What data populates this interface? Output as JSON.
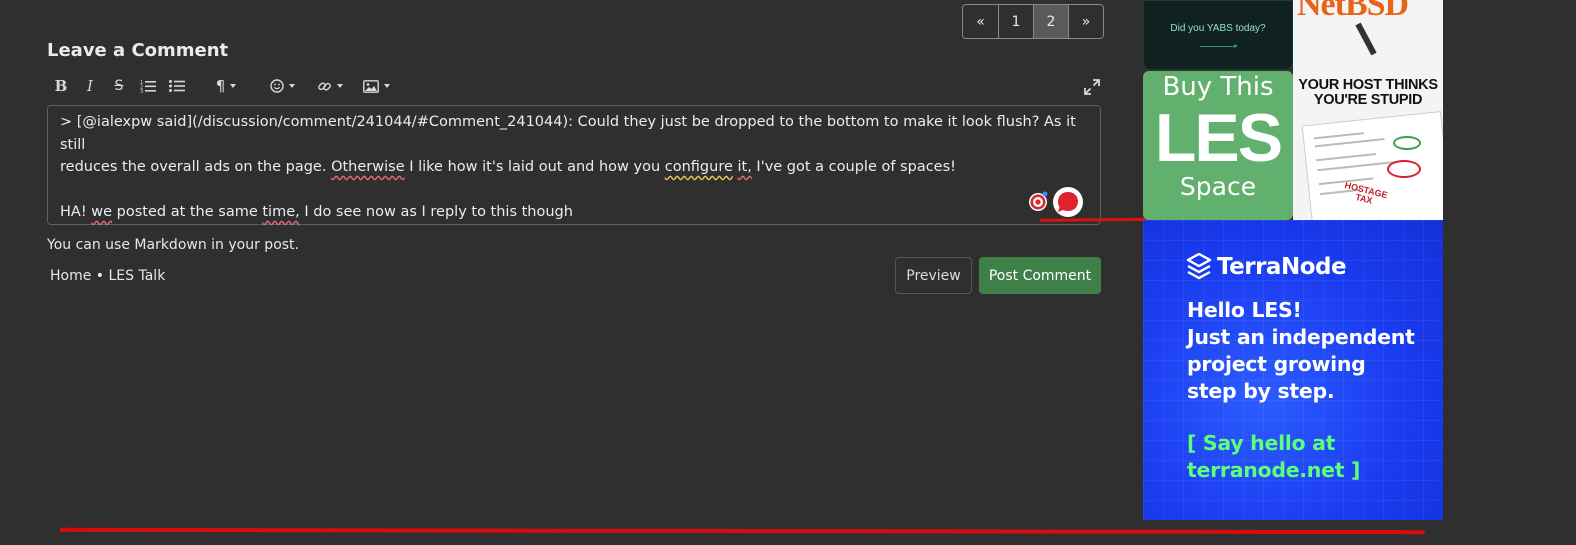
{
  "pagination": {
    "items": [
      {
        "label": "«",
        "active": false
      },
      {
        "label": "1",
        "active": false
      },
      {
        "label": "2",
        "active": true
      },
      {
        "label": "»",
        "active": false
      }
    ]
  },
  "comment_form": {
    "heading": "Leave a Comment",
    "toolbar": {
      "bold": "B",
      "italic": "I",
      "strike": "S",
      "icons": [
        "bold-icon",
        "italic-icon",
        "strikethrough-icon",
        "ordered-list-icon",
        "unordered-list-icon",
        "paragraph-icon",
        "emoji-icon",
        "link-icon",
        "image-icon",
        "expand-icon"
      ]
    },
    "editor": {
      "line1_pre": "> [@ialexpw said](/discussion/comment/241044/#Comment_241044): Could they just be dropped to the bottom to make it look flush? As it still",
      "line2_pre": "reduces the overall ads on the page. ",
      "line2_w1": "Otherwise",
      "line2_mid": " I like how it's laid out and how you ",
      "line2_w2": "configure",
      "line2_sp": " ",
      "line2_w3": "it,",
      "line2_post": " I've got a couple of spaces!",
      "line4_pre": "HA! ",
      "line4_w1": "we",
      "line4_mid": " posted at the same ",
      "line4_w2": "time,",
      "line4_post": " I do see now as I reply to this though"
    },
    "markdown_hint": "You can use Markdown in your post.",
    "breadcrumb": "Home • LES Talk",
    "preview_label": "Preview",
    "post_label": "Post Comment",
    "colors": {
      "post_button": "#3e8048",
      "spell_error": "#e06a78",
      "grammar": "#e8c35a",
      "annotation": "#e01010"
    }
  },
  "ads": {
    "yabs": {
      "text": "Did you YABS today?"
    },
    "netbsd": {
      "logo": "NetBSD",
      "headline_1": "YOUR HOST THINKS",
      "headline_2": "YOU'RE STUPID",
      "stamp_1": "HOSTAGE",
      "stamp_2": "TAX"
    },
    "les": {
      "line1": "Buy This",
      "line2": "LES",
      "line3": "Space"
    },
    "terranode": {
      "brand": "TerraNode",
      "message_1": "Hello LES!",
      "message_2": "Just an independent",
      "message_3": "project growing",
      "message_4": "step by step.",
      "cta_1": "[ Say hello at",
      "cta_2": "terranode.net ]"
    }
  }
}
